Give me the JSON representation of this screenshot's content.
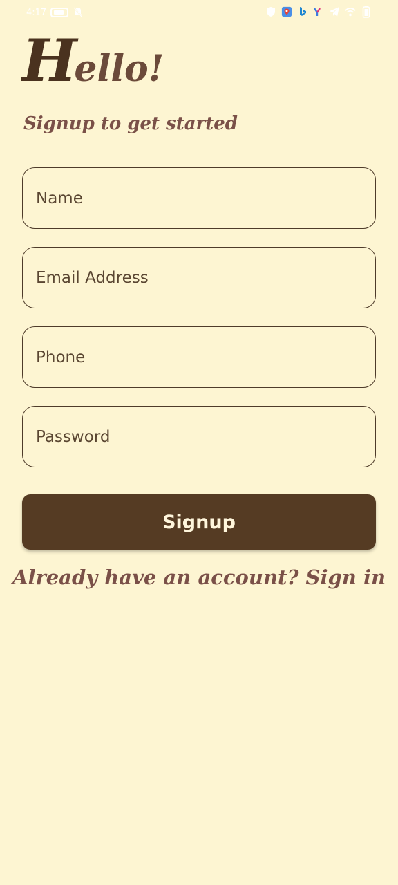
{
  "status_bar": {
    "time": "4:17",
    "icons": [
      "battery-icon",
      "notifications-off-icon",
      "shield-icon",
      "maps-icon",
      "bing-icon",
      "yandex-icon",
      "telegram-icon",
      "wifi-icon",
      "battery-level-icon"
    ]
  },
  "heading": {
    "hello_first_letter": "H",
    "hello_rest": "ello!",
    "subtitle": "Signup to get started"
  },
  "form": {
    "name_placeholder": "Name",
    "email_placeholder": "Email Address",
    "phone_placeholder": "Phone",
    "password_placeholder": "Password",
    "submit_label": "Signup"
  },
  "footer": {
    "signin_text": "Already have an account? Sign in"
  },
  "colors": {
    "background": "#FDF5D2",
    "primary_brown": "#553B23",
    "accent_text": "#7A5048",
    "button_text": "#FFF6DC"
  }
}
